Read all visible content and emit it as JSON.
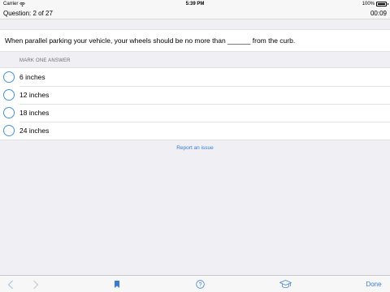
{
  "status_bar": {
    "carrier": "Carrier",
    "time": "5:39 PM",
    "battery": "100%"
  },
  "nav": {
    "question_progress": "Question: 2 of 27",
    "timer": "00:09"
  },
  "question": {
    "text": "When parallel parking your vehicle, your wheels should be no more than ______ from the curb."
  },
  "answers": {
    "header": "MARK ONE ANSWER",
    "options": [
      {
        "label": "6 inches"
      },
      {
        "label": "12 inches"
      },
      {
        "label": "18 inches"
      },
      {
        "label": "24 inches"
      }
    ]
  },
  "report_issue": "Report an issue",
  "toolbar": {
    "done_label": "Done",
    "icons": [
      "chevron-left-icon",
      "chevron-right-icon",
      "bookmark-icon",
      "help-icon",
      "graduation-cap-icon"
    ]
  },
  "colors": {
    "accent": "#3a7bd5",
    "radio": "#4a90d9",
    "background": "#efeff4"
  }
}
